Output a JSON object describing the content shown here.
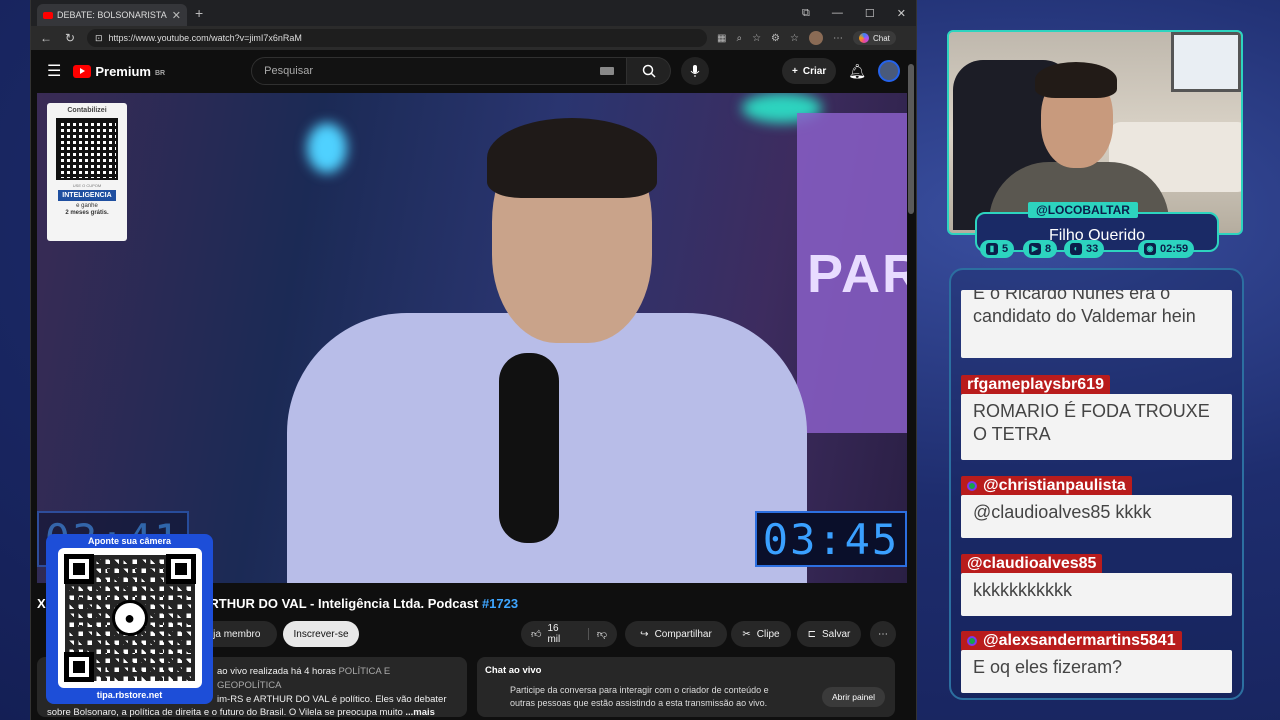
{
  "browser": {
    "tab_title": "DEBATE: BOLSONARISTA X MBL",
    "url": "https://www.youtube.com/watch?v=jimI7x6nRaM",
    "chat_button": "Chat"
  },
  "youtube": {
    "logo": "Premium",
    "region": "BR",
    "search_placeholder": "Pesquisar",
    "create_label": "Criar",
    "sponsor": {
      "brand": "Contabilizei",
      "coupon_hint": "USE O CUPOM",
      "coupon_code": "INTELIGENCIA",
      "offer_line1": "e ganhe",
      "offer_line2": "2 meses grátis."
    },
    "video_timer": "03:45",
    "video_timer_left": "03:41",
    "title_main": "X MBL: RONY GABRIEL E ARTHUR DO VAL - Inteligência Ltda. Podcast ",
    "title_ep": "#1723",
    "member_btn": "eja membro",
    "subscribe_btn": "Inscrever-se",
    "likes": "16 mil",
    "share": "Compartilhar",
    "clip": "Clipe",
    "save": "Salvar",
    "desc_line1": "ao vivo realizada há 4 horas",
    "desc_cat": "POLÍTICA E GEOPOLÍTICA",
    "desc_line2": "im-RS e ARTHUR DO VAL é político. Eles vão debater",
    "desc_line3": "sobre Bolsonaro, a política de direita e o futuro do Brasil. O Vilela se preocupa muito",
    "desc_more": "...mais",
    "live_chat_title": "Chat ao vivo",
    "live_chat_text": "Participe da conversa para interagir com o criador de conteúdo e outras pessoas que estão assistindo a esta transmissão ao vivo.",
    "open_panel": "Abrir painel"
  },
  "stream": {
    "qr_top": "Aponte sua câmera",
    "qr_bottom": "tipa.rbstore.net",
    "handle": "@LOCOBALTAR",
    "name": "Filho Querido",
    "stats": {
      "s1": "5",
      "s2": "8",
      "s3": "33",
      "timer": "02:59"
    },
    "chat": [
      {
        "user": "",
        "text": "E o Ricardo Nunes era o candidato do Valdemar hein"
      },
      {
        "user": "rfgameplaysbr619",
        "text": "ROMARIO É FODA TROUXE O TETRA"
      },
      {
        "user": "@christianpaulista",
        "text": "@claudioalves85 kkkk"
      },
      {
        "user": "@claudioalves85",
        "text": "kkkkkkkkkkk"
      },
      {
        "user": "@alexsandermartins5841",
        "text": "E oq eles fizeram?"
      }
    ]
  }
}
